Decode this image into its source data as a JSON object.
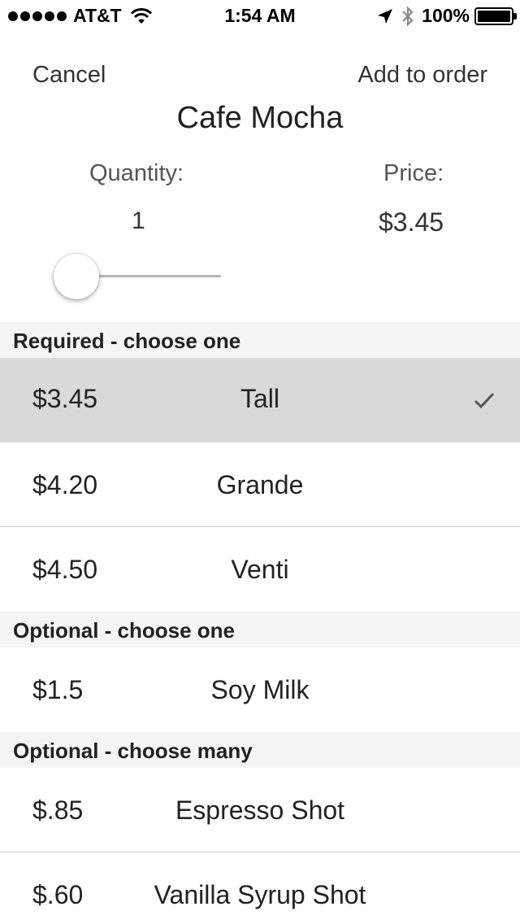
{
  "status_bar": {
    "carrier": "AT&T",
    "time": "1:54 AM",
    "battery_percent": "100%"
  },
  "nav": {
    "cancel_label": "Cancel",
    "add_label": "Add to order",
    "title": "Cafe Mocha"
  },
  "order": {
    "quantity_label": "Quantity:",
    "price_label": "Price:",
    "quantity": "1",
    "price": "$3.45"
  },
  "sections": [
    {
      "header": "Required - choose one",
      "items": [
        {
          "price": "$3.45",
          "name": "Tall",
          "selected": true
        },
        {
          "price": "$4.20",
          "name": "Grande",
          "selected": false
        },
        {
          "price": "$4.50",
          "name": "Venti",
          "selected": false
        }
      ]
    },
    {
      "header": "Optional - choose one",
      "items": [
        {
          "price": "$1.5",
          "name": "Soy Milk",
          "selected": false
        }
      ]
    },
    {
      "header": "Optional - choose many",
      "items": [
        {
          "price": "$.85",
          "name": "Espresso Shot",
          "selected": false
        },
        {
          "price": "$.60",
          "name": "Vanilla Syrup Shot",
          "selected": false
        }
      ]
    }
  ]
}
